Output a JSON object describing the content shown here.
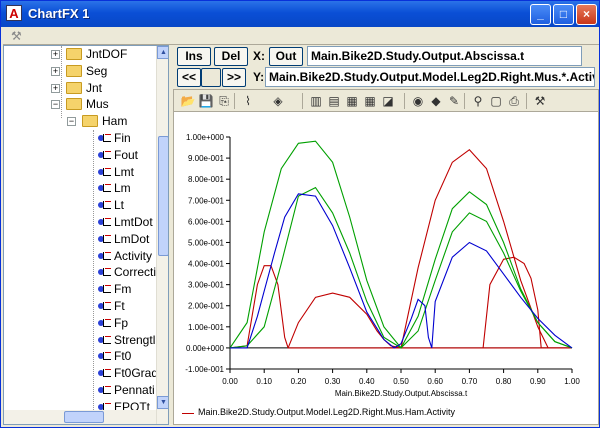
{
  "window": {
    "title": "ChartFX 1"
  },
  "tree": {
    "items": [
      {
        "label": "JntDOF",
        "kind": "folder",
        "depth": 0,
        "expand": "+"
      },
      {
        "label": "Seg",
        "kind": "folder",
        "depth": 0,
        "expand": "+"
      },
      {
        "label": "Jnt",
        "kind": "folder",
        "depth": 0,
        "expand": "+"
      },
      {
        "label": "Mus",
        "kind": "folder",
        "depth": 0,
        "expand": "−"
      },
      {
        "label": "Ham",
        "kind": "folder",
        "depth": 1,
        "expand": "−"
      },
      {
        "label": "Fin",
        "kind": "var",
        "depth": 2
      },
      {
        "label": "Fout",
        "kind": "var",
        "depth": 2
      },
      {
        "label": "Lmt",
        "kind": "var",
        "depth": 2
      },
      {
        "label": "Lm",
        "kind": "var",
        "depth": 2
      },
      {
        "label": "Lt",
        "kind": "var",
        "depth": 2
      },
      {
        "label": "LmtDot",
        "kind": "var",
        "depth": 2
      },
      {
        "label": "LmDot",
        "kind": "var",
        "depth": 2
      },
      {
        "label": "Activity",
        "kind": "var",
        "depth": 2
      },
      {
        "label": "Correcti",
        "kind": "var",
        "depth": 2
      },
      {
        "label": "Fm",
        "kind": "var",
        "depth": 2
      },
      {
        "label": "Ft",
        "kind": "var",
        "depth": 2
      },
      {
        "label": "Fp",
        "kind": "var",
        "depth": 2
      },
      {
        "label": "Strengtl",
        "kind": "var",
        "depth": 2
      },
      {
        "label": "Ft0",
        "kind": "var",
        "depth": 2
      },
      {
        "label": "Ft0Grad",
        "kind": "var",
        "depth": 2
      },
      {
        "label": "Pennati",
        "kind": "var",
        "depth": 2
      },
      {
        "label": "EPOTt",
        "kind": "var",
        "depth": 2
      }
    ]
  },
  "controls": {
    "ins_label": "Ins",
    "del_label": "Del",
    "x_label": "X:",
    "out_label": "Out",
    "x_value": "Main.Bike2D.Study.Output.Abscissa.t",
    "prev_label": "<<",
    "next_label": ">>",
    "y_label": "Y:",
    "y_value": "Main.Bike2D.Study.Output.Model.Leg2D.Right.Mus.*.Activity"
  },
  "toolbar_icons": [
    "open-icon",
    "save-icon",
    "copy-icon",
    "gallery-icon",
    "color-icon",
    "grid-vert-icon",
    "grid-horz-icon",
    "legend-icon",
    "table-icon",
    "axis-icon",
    "3d-icon",
    "rotate-icon",
    "properties-icon",
    "zoom-icon",
    "preview-icon",
    "print-icon",
    "tools-icon"
  ],
  "chart_data": {
    "type": "line",
    "xlabel": "Main.Bike2D.Study.Output.Abscissa.t",
    "ylabel": "",
    "xlim": [
      0,
      1
    ],
    "ylim": [
      -0.1,
      1.0
    ],
    "x_ticks": [
      "0.00",
      "0.10",
      "0.20",
      "0.30",
      "0.40",
      "0.50",
      "0.60",
      "0.70",
      "0.80",
      "0.90",
      "1.00"
    ],
    "y_ticks": [
      "-1.00e-001",
      "0.00e+000",
      "1.00e-001",
      "2.00e-001",
      "3.00e-001",
      "4.00e-001",
      "5.00e-001",
      "6.00e-001",
      "7.00e-001",
      "8.00e-001",
      "9.00e-001",
      "1.00e+000"
    ],
    "grid": false,
    "legend": "bottom",
    "series": [
      {
        "name": "Main.Bike2D.Study.Output.Model.Leg2D.Right.Mus.Ham.Activity",
        "color": "#c00000",
        "x": [
          0.0,
          0.05,
          0.08,
          0.1,
          0.12,
          0.14,
          0.16,
          0.17,
          0.5,
          0.6,
          0.7,
          0.8,
          0.9,
          0.92,
          1.0
        ],
        "y": [
          0.0,
          0.01,
          0.3,
          0.39,
          0.39,
          0.3,
          0.05,
          0.0,
          0.0,
          0.0,
          0.0,
          0.0,
          0.0,
          0.0,
          0.0
        ]
      },
      {
        "color": "#c00000",
        "x": [
          0.17,
          0.2,
          0.25,
          0.3,
          0.35,
          0.4,
          0.43,
          0.45,
          0.47,
          0.5
        ],
        "y": [
          0.0,
          0.12,
          0.24,
          0.26,
          0.24,
          0.16,
          0.08,
          0.04,
          0.01,
          0.0
        ]
      },
      {
        "color": "#c00000",
        "x": [
          0.45,
          0.5,
          0.55,
          0.6,
          0.65,
          0.7,
          0.75,
          0.8,
          0.85,
          0.9,
          0.93
        ],
        "y": [
          0.0,
          0.0,
          0.38,
          0.7,
          0.88,
          0.94,
          0.85,
          0.6,
          0.32,
          0.1,
          0.0
        ]
      },
      {
        "color": "#c00000",
        "x": [
          0.74,
          0.76,
          0.8,
          0.83,
          0.86,
          0.88,
          0.9,
          0.91,
          1.0
        ],
        "y": [
          0.0,
          0.3,
          0.42,
          0.43,
          0.4,
          0.33,
          0.18,
          0.0,
          0.0
        ]
      },
      {
        "color": "#00a000",
        "x": [
          0.0,
          0.05,
          0.1,
          0.15,
          0.2,
          0.25,
          0.3,
          0.35,
          0.4,
          0.45,
          0.5,
          0.55,
          0.6,
          0.65,
          0.7,
          0.75,
          0.8,
          0.85,
          0.9,
          0.95,
          1.0
        ],
        "y": [
          0.0,
          0.12,
          0.55,
          0.85,
          0.97,
          0.98,
          0.88,
          0.62,
          0.32,
          0.1,
          0.0,
          0.15,
          0.42,
          0.66,
          0.74,
          0.68,
          0.5,
          0.28,
          0.12,
          0.03,
          0.0
        ]
      },
      {
        "color": "#00a000",
        "x": [
          0.0,
          0.05,
          0.1,
          0.15,
          0.2,
          0.25,
          0.3,
          0.35,
          0.4,
          0.45,
          0.5,
          0.55,
          0.6,
          0.65,
          0.7,
          0.75,
          0.8,
          0.85,
          0.9,
          0.95,
          1.0
        ],
        "y": [
          0.0,
          0.01,
          0.1,
          0.4,
          0.72,
          0.76,
          0.64,
          0.45,
          0.22,
          0.05,
          0.0,
          0.08,
          0.32,
          0.55,
          0.64,
          0.6,
          0.45,
          0.27,
          0.12,
          0.03,
          0.0
        ]
      },
      {
        "color": "#0000d0",
        "x": [
          0.0,
          0.05,
          0.08,
          0.1,
          0.13,
          0.16,
          0.2,
          0.25,
          0.3,
          0.35,
          0.4,
          0.45,
          0.48,
          0.5,
          0.53,
          0.55,
          0.57,
          0.58,
          0.59,
          0.6,
          0.65,
          0.7,
          0.75,
          0.8,
          0.85,
          0.9,
          0.95,
          1.0
        ],
        "y": [
          0.0,
          0.0,
          0.15,
          0.27,
          0.45,
          0.62,
          0.73,
          0.72,
          0.58,
          0.38,
          0.17,
          0.04,
          0.0,
          0.02,
          0.14,
          0.23,
          0.2,
          0.05,
          0.0,
          0.22,
          0.43,
          0.5,
          0.46,
          0.35,
          0.24,
          0.14,
          0.06,
          0.0
        ]
      }
    ]
  }
}
